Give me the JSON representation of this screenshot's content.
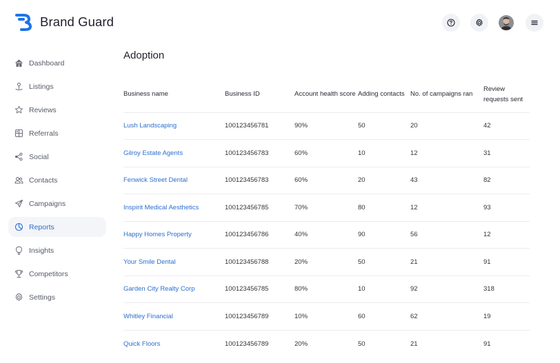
{
  "app": {
    "name": "Brand Guard",
    "brand_color": "#1e73e8",
    "accent_color": "#2b6fcf"
  },
  "topbar": {
    "help_icon": "question-circle-icon",
    "settings_icon": "gear-icon",
    "avatar": "user-avatar",
    "menu_icon": "hamburger-menu-icon"
  },
  "sidebar": {
    "items": [
      {
        "label": "Dashboard",
        "icon": "home-icon"
      },
      {
        "label": "Listings",
        "icon": "map-pin-icon"
      },
      {
        "label": "Reviews",
        "icon": "star-icon"
      },
      {
        "label": "Referrals",
        "icon": "grid-icon"
      },
      {
        "label": "Social",
        "icon": "share-icon"
      },
      {
        "label": "Contacts",
        "icon": "users-icon"
      },
      {
        "label": "Campaigns",
        "icon": "send-icon"
      },
      {
        "label": "Reports",
        "icon": "pie-chart-icon",
        "active": true
      },
      {
        "label": "Insights",
        "icon": "lightbulb-icon"
      },
      {
        "label": "Competitors",
        "icon": "trophy-icon"
      },
      {
        "label": "Settings",
        "icon": "gear-icon"
      }
    ]
  },
  "main": {
    "title": "Adoption",
    "table": {
      "headers": [
        "Business name",
        "Business ID",
        "Account health score",
        "Adding contacts",
        "No. of campaigns ran",
        "Review requests sent"
      ],
      "rows": [
        [
          "Lush Landscaping",
          "100123456781",
          "90%",
          "50",
          "20",
          "42"
        ],
        [
          "Gilroy Estate Agents",
          "100123456783",
          "60%",
          "10",
          "12",
          "31"
        ],
        [
          "Fenwick Street Dental",
          "100123456783",
          "60%",
          "20",
          "43",
          "82"
        ],
        [
          "Inspirit Medical Aesthetics",
          "100123456785",
          "70%",
          "80",
          "12",
          "93"
        ],
        [
          "Happy Homes Property",
          "100123456786",
          "40%",
          "90",
          "56",
          "12"
        ],
        [
          "Your Smile Dental",
          "100123456788",
          "20%",
          "50",
          "21",
          "91"
        ],
        [
          "Garden City Realty Corp",
          "100123456785",
          "80%",
          "10",
          "92",
          "318"
        ],
        [
          "Whitley Financial",
          "100123456789",
          "10%",
          "60",
          "62",
          "19"
        ],
        [
          "Quick Floors",
          "100123456789",
          "20%",
          "50",
          "21",
          "91"
        ]
      ]
    }
  }
}
